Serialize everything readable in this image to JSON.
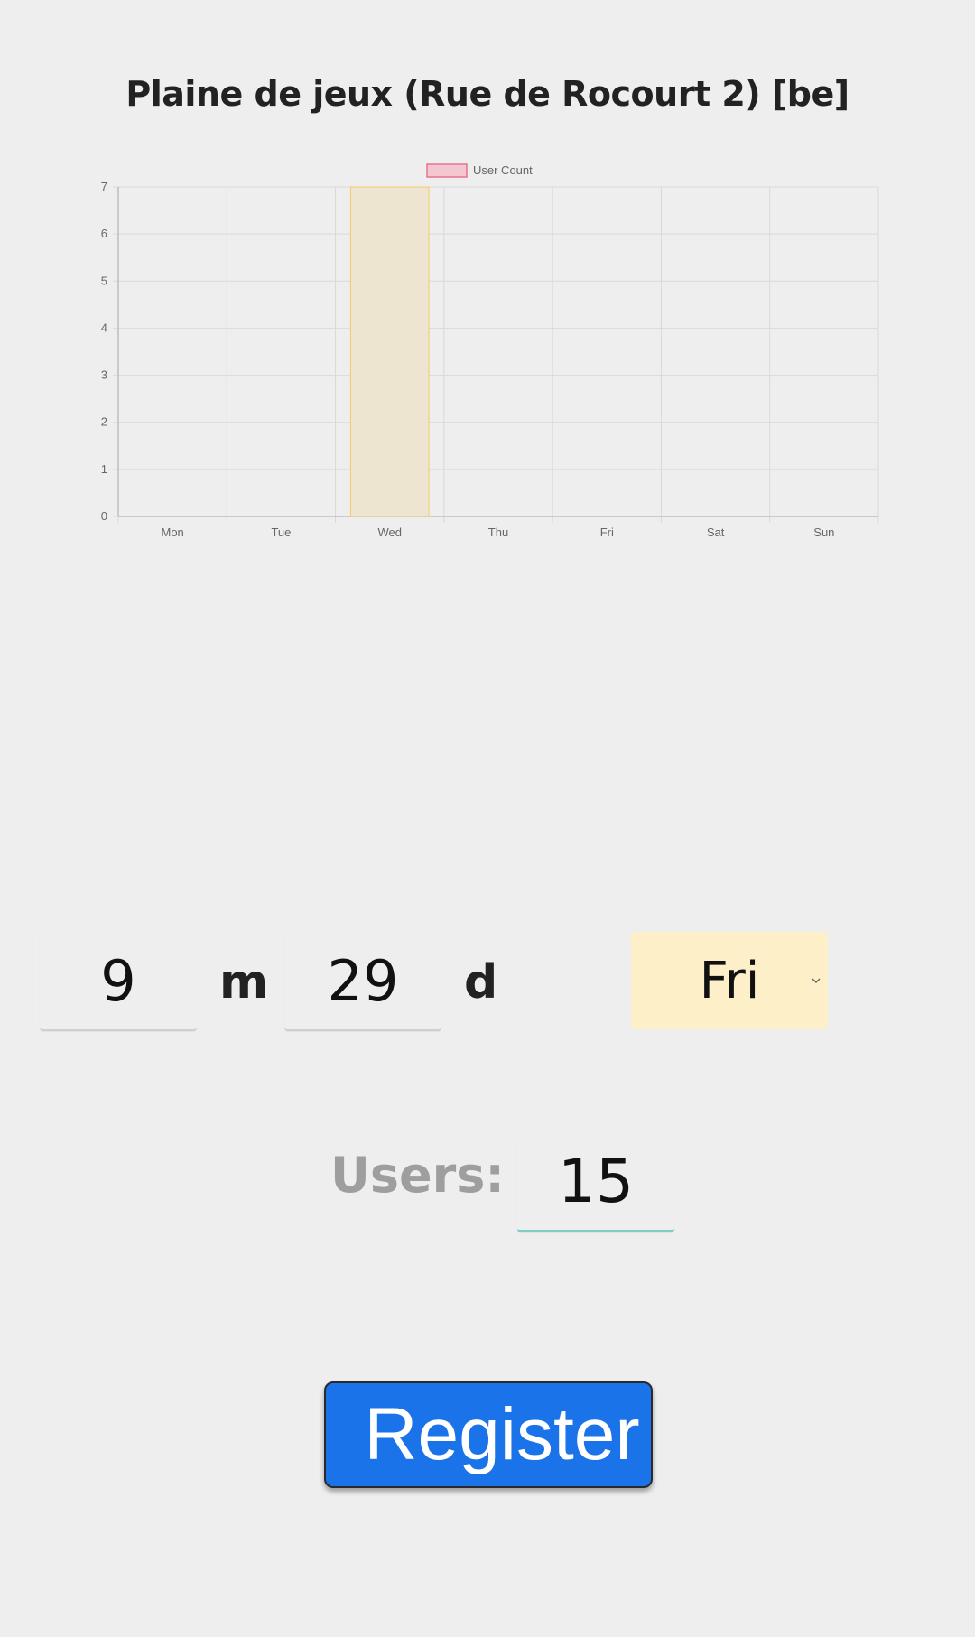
{
  "page": {
    "title": "Plaine de jeux (Rue de Rocourt 2) [be]"
  },
  "chart_data": {
    "type": "bar",
    "categories": [
      "Mon",
      "Tue",
      "Wed",
      "Thu",
      "Fri",
      "Sat",
      "Sun"
    ],
    "series": [
      {
        "name": "User Count",
        "values": [
          0,
          0,
          7,
          0,
          0,
          0,
          0
        ],
        "legend_color": "#f4c7d0",
        "legend_border": "#e57390"
      }
    ],
    "highlighted_bar": {
      "category": "Wed",
      "fill": "#ede5d0",
      "border": "#f5c96b"
    },
    "ylim": [
      0,
      7
    ],
    "yticks": [
      0,
      1,
      2,
      3,
      4,
      5,
      6,
      7
    ],
    "legend_position": "top",
    "grid": true
  },
  "form": {
    "month_value": "9",
    "month_unit": "m",
    "day_value": "29",
    "day_unit": "d",
    "weekday_selected": "Fri",
    "users_label": "Users:",
    "users_value": "15",
    "register_label": "Register"
  },
  "colors": {
    "background": "#eeeeee",
    "weekday_select_bg": "#fdf0c8",
    "users_input_underline": "#80cbc4",
    "register_button": "#1a73e8"
  }
}
